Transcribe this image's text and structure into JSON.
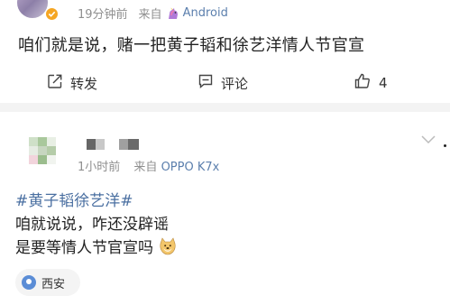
{
  "post1": {
    "time": "19分钟前",
    "source_prefix": "来自",
    "source_name": "Android",
    "text": "咱们就是说，赌一把黄子韬和徐艺洋情人节官宣",
    "actions": {
      "repost_label": "转发",
      "comment_label": "评论",
      "like_count": "4"
    }
  },
  "post2": {
    "time": "1小时前",
    "source_prefix": "来自",
    "source_name": "OPPO K7x",
    "topic": "#黄子韬徐艺洋#",
    "line1": "咱就说说，咋还没辟谣",
    "line2": "是要等情人节官宣吗",
    "location": "西安"
  },
  "colors": {
    "link_blue": "#4a6fa1",
    "meta_gray": "#8f8f8f",
    "verified_badge": "#f5a623",
    "divider": "#f3f3f3"
  },
  "icons": {
    "repost": "repost-icon",
    "comment": "comment-icon",
    "like": "thumbs-up-icon",
    "more": "chevron-down-icon",
    "location": "location-pin-icon",
    "emoji": "doge-emoji"
  }
}
